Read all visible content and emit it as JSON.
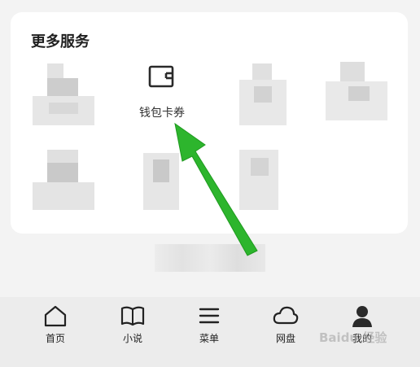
{
  "services": {
    "title": "更多服务",
    "wallet": {
      "label": "钱包卡券",
      "icon": "wallet-icon"
    }
  },
  "tabbar": {
    "items": [
      {
        "label": "首页",
        "icon": "home-icon"
      },
      {
        "label": "小说",
        "icon": "book-icon"
      },
      {
        "label": "菜单",
        "icon": "menu-icon"
      },
      {
        "label": "网盘",
        "icon": "cloud-icon"
      },
      {
        "label": "我的",
        "icon": "profile-icon"
      }
    ]
  },
  "annotation": {
    "arrow_color": "#2db52d"
  },
  "colors": {
    "card": "#ffffff",
    "background": "#f3f3f3",
    "tabbar": "#ececec"
  }
}
